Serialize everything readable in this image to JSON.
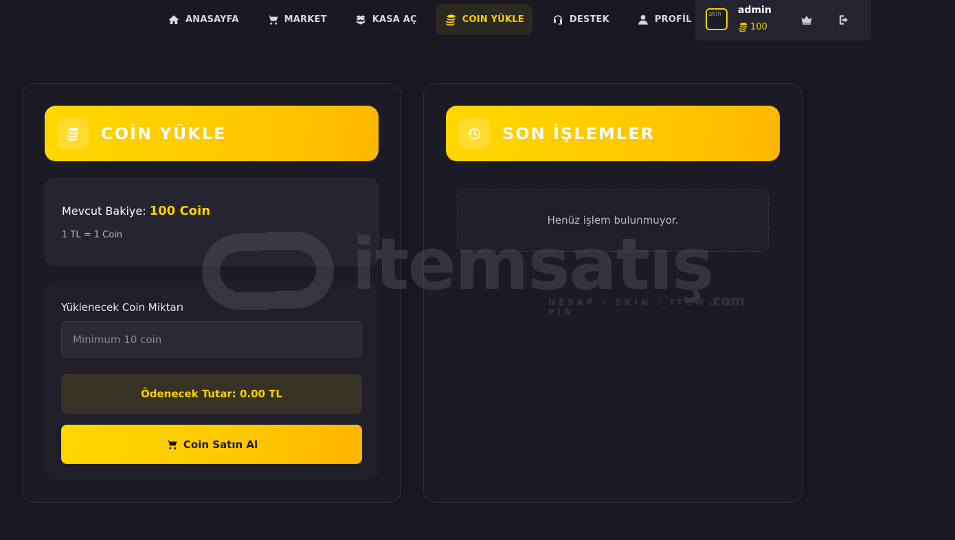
{
  "nav": {
    "items": [
      {
        "label": "ANASAYFA",
        "icon": "home-icon",
        "active": false
      },
      {
        "label": "MARKET",
        "icon": "cart-icon",
        "active": false
      },
      {
        "label": "KASA AÇ",
        "icon": "box-icon",
        "active": false
      },
      {
        "label": "COIN YÜKLE",
        "icon": "coins-icon",
        "active": true
      },
      {
        "label": "DESTEK",
        "icon": "headset-icon",
        "active": false
      },
      {
        "label": "PROFİL",
        "icon": "user-icon",
        "active": false
      }
    ]
  },
  "user": {
    "avatar_alt": "akin",
    "name": "admin",
    "coins": "100",
    "coin_icon": "coins-icon",
    "crown_icon": "crown-icon",
    "logout_icon": "logout-icon"
  },
  "coin_panel": {
    "title": "COİN YÜKLE",
    "icon": "coins-icon",
    "balance_label": "Mevcut Bakiye:",
    "balance_value": "100 Coin",
    "rate": "1 TL = 1 Coin",
    "amount_label": "Yüklenecek Coin Miktarı",
    "amount_placeholder": "Minimum 10 coin",
    "amount_value": "",
    "total_text": "Ödenecek Tutar: 0.00 TL",
    "buy_label": "Coin Satın Al",
    "buy_icon": "cart-icon"
  },
  "history_panel": {
    "title": "SON İŞLEMLER",
    "icon": "history-icon",
    "empty_text": "Henüz işlem bulunmuyor."
  },
  "watermark": {
    "brand": "itemsatış",
    "tagline": "HESAP / SKIN / ITEM / E-PIN",
    "domain": ".com"
  },
  "colors": {
    "accent": "#ffd000",
    "background": "#171722",
    "panel": "#1b1b25"
  }
}
